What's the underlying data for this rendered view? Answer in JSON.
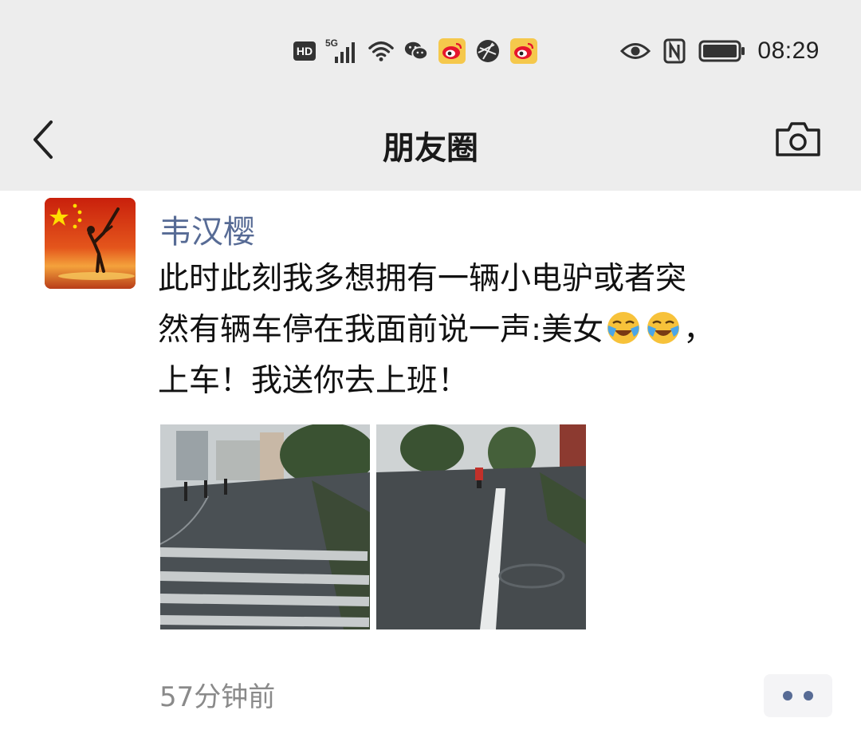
{
  "status_bar": {
    "hd": "HD",
    "network": "5G",
    "time": "08:29",
    "icons": [
      "hd-icon",
      "signal-5g-icon",
      "wifi-icon",
      "wechat-icon",
      "weibo-icon",
      "browser-icon",
      "weibo-icon",
      "eye-icon",
      "nfc-icon",
      "battery-icon"
    ]
  },
  "nav": {
    "title": "朋友圈",
    "back_icon": "back-arrow-icon",
    "camera_icon": "camera-icon"
  },
  "post": {
    "author": "韦汉樱",
    "text_line1": "此时此刻我多想拥有一辆小电驴或者突",
    "text_line2a": "然有辆车停在我面前说一声:美女",
    "emoji": "face-with-tears-emoji",
    "text_line2b": "，",
    "text_line3": "上车！我送你去上班！",
    "photos": [
      {
        "name": "rainy-crosswalk-photo"
      },
      {
        "name": "rainy-road-scooter-photo"
      }
    ],
    "timestamp": "57分钟前",
    "more_icon": "more-dots-icon"
  },
  "colors": {
    "bar_bg": "#ededed",
    "author_link": "#576b95",
    "timestamp": "#8a8a8a"
  }
}
